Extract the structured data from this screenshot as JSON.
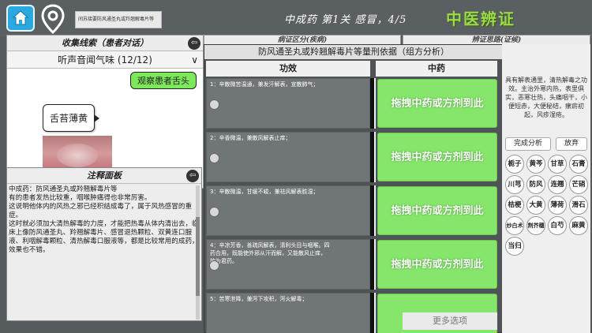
{
  "topbar": {
    "search_text": "间苏接要防风通圣丸或羚翘解毒片等",
    "level_title": "中成药  第1关  感冒，4/5",
    "brand": "中医辨证"
  },
  "back_panels": [
    "病证区分(疾病)",
    "辨证思路(证候)"
  ],
  "clue": {
    "title": "收集线索（患者对话）",
    "selector": "听声音闻气味 (12/12)",
    "bubble_doctor": "观察患者舌头",
    "bubble_patient": "舌苔薄黄"
  },
  "notes": {
    "title": "注释面板",
    "body": "中成药：防风通圣丸或羚翘解毒片等\n有的患者发热比较重，咽喉肿痛得也非常厉害。\n这说明他体内的风热之邪已经积结成毒了，属于风热感冒的重症。\n这时就必须加大清热解毒的力度，才能把热毒从体内清出去，临床上像防风通圣丸、羚翘解毒片、感冒退热颗粒、双黄连口服液、利咽解毒颗粒、清热解毒口服液等，都是比较常用的成药，效果也不错。"
  },
  "dialog": {
    "title": "防风通圣丸或羚翘解毒片等量刑依据（组方分析）",
    "col_func": "功效",
    "col_herb": "中药",
    "rows": [
      {
        "text": "1：辛散微苦温通，兼发汗解表，宣散肺气；",
        "drop": "拖拽中药或方剂到此"
      },
      {
        "text": "2：辛香微温，兼散风解表止痒；",
        "drop": "拖拽中药或方剂到此"
      },
      {
        "text": "3：辛散微温，甘缓不峻，兼祛风解表胜湿；",
        "drop": "拖拽中药或方剂到此"
      },
      {
        "text": "4：辛凉芳香，善疏风解表，清利头目与咽喉。四\n药合用，既能使外邪从汗而解，又能散风止痒，\n故为君药。",
        "drop": "拖拽中药或方剂到此"
      },
      {
        "text": "5：苦寒泄降，兼泻下攻积，泻火解毒；",
        "drop": ""
      }
    ]
  },
  "right": {
    "description": "具有解表通里，清热解毒之功效。主治外寒内热，表里俱实，恶寒壮热，头痛咽干，小便短赤，大便秘结，瘰疬初起，风疹湿疮。",
    "finish_label": "完成分析",
    "give_up_label": "放弃",
    "herbs": [
      "栀子",
      "黄芩",
      "甘草",
      "石膏",
      "川芎",
      "防风",
      "连翘",
      "芒硝",
      "桔梗",
      "大黄",
      "薄荷",
      "滑石",
      "炒白术",
      "荆芥穗",
      "白芍",
      "麻黄",
      "当归"
    ]
  },
  "more_options": "更多选项"
}
